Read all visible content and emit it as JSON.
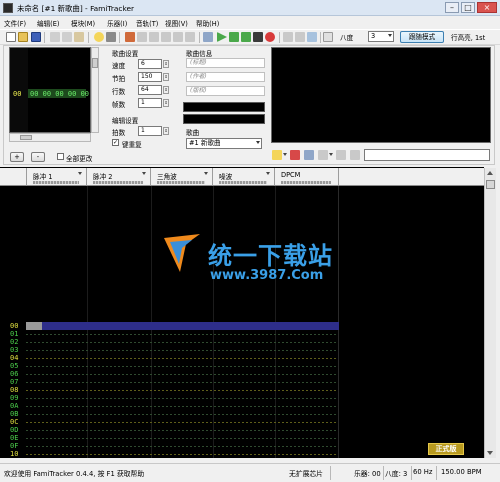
{
  "window": {
    "title": "未命名 [#1 新歌曲] - FamiTracker",
    "controls": {
      "minimize": "–",
      "maximize": "□",
      "close": "×"
    }
  },
  "menu": [
    "文件(F)",
    "编辑(E)",
    "模块(M)",
    "乐器(I)",
    "音轨(T)",
    "视图(V)",
    "帮助(H)"
  ],
  "toolbar": {
    "octave_label": "八度",
    "octave_value": "3",
    "follow_mode_label": "跟随模式",
    "row_highlight_label": "行高亮, 1st"
  },
  "frame_panel": {
    "row": "00",
    "cells": "00 00 00 00 00",
    "add_label": "+",
    "remove_label": "-",
    "change_all_label": "全部更改"
  },
  "song_settings": {
    "heading": "歌曲设置",
    "fields": [
      {
        "label": "速度",
        "value": "6"
      },
      {
        "label": "节拍",
        "value": "150"
      },
      {
        "label": "行数",
        "value": "64"
      },
      {
        "label": "帧数",
        "value": "1"
      }
    ]
  },
  "edit_settings": {
    "heading": "编辑设置",
    "step_label": "拍数",
    "step_value": "1",
    "key_repeat_label": "键重复",
    "key_repeat_checked": true
  },
  "song_info": {
    "heading": "歌曲信息",
    "title_placeholder": "(标题)",
    "author_placeholder": "(作者)",
    "copyright_placeholder": "(版权)"
  },
  "song_select": {
    "heading": "歌曲",
    "value": "#1 新歌曲"
  },
  "channels": [
    "脉冲 1",
    "脉冲 2",
    "三角波",
    "噪波",
    "DPCM"
  ],
  "pattern_rows": [
    "00",
    "01",
    "02",
    "03",
    "04",
    "05",
    "06",
    "07",
    "08",
    "09",
    "0A",
    "0B",
    "0C",
    "0D",
    "0E",
    "0F",
    "10"
  ],
  "watermark": {
    "main": "统一下载站",
    "sub": "www.3987.Com",
    "badge": "正式版"
  },
  "status": {
    "help": "欢迎使用 FamiTracker 0.4.4, 按 F1 获取帮助",
    "chip": "无扩展芯片",
    "instrument": "乐器: 00",
    "octave": "八度: 3",
    "refresh": "60 Hz",
    "bpm": "150.00 BPM"
  }
}
